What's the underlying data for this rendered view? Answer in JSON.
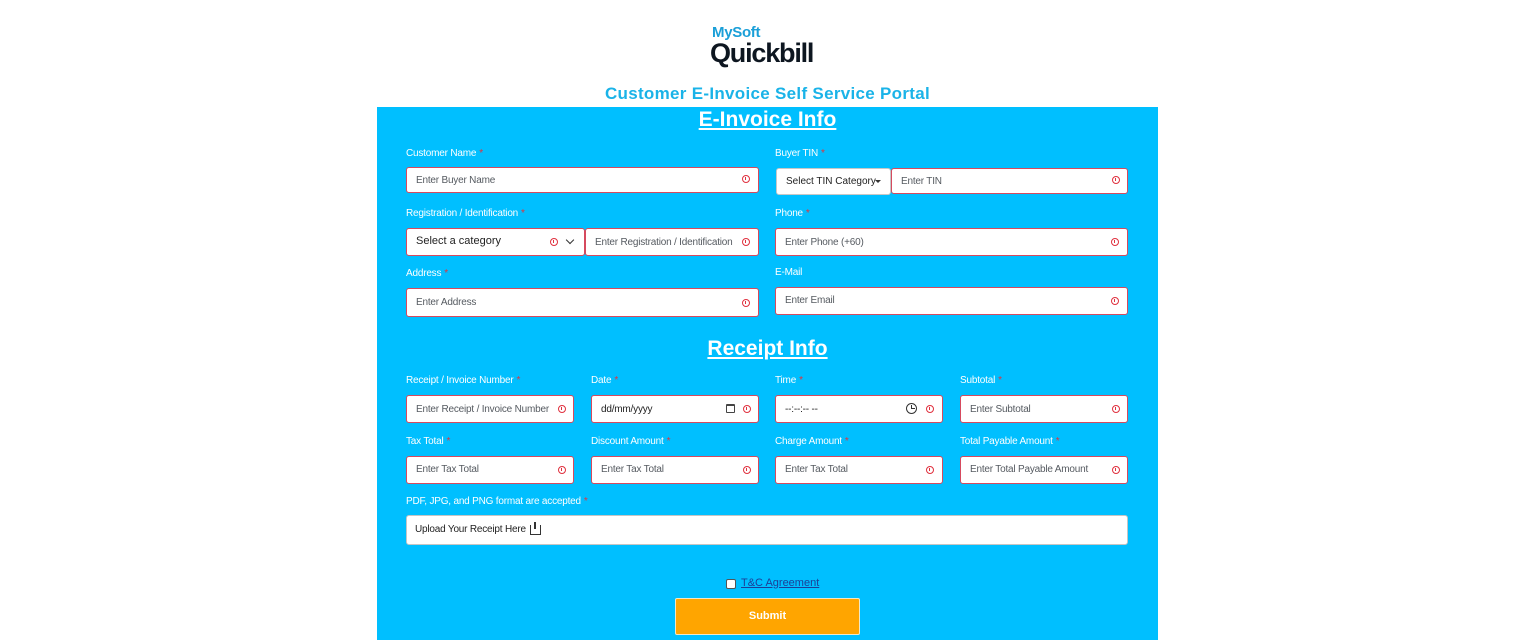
{
  "logo": {
    "brand_top": "MySoft",
    "brand_main": "Quickbill"
  },
  "portal_title": "Customer E-Invoice Self Service Portal",
  "einvoice": {
    "section_title": "E-Invoice Info",
    "customer_name": {
      "label": "Customer Name",
      "required": "*",
      "placeholder": "Enter Buyer Name"
    },
    "buyer_tin": {
      "label": "Buyer TIN",
      "required": "*",
      "select_value": "Select TIN Category",
      "placeholder": "Enter TIN"
    },
    "registration": {
      "label": "Registration / Identification",
      "required": "*",
      "select_value": "Select a category",
      "placeholder": "Enter Registration / Identification"
    },
    "phone": {
      "label": "Phone",
      "required": "*",
      "placeholder": "Enter Phone (+60)"
    },
    "address": {
      "label": "Address",
      "required": "*",
      "placeholder": "Enter Address"
    },
    "email": {
      "label": "E-Mail",
      "placeholder": "Enter Email"
    }
  },
  "receipt": {
    "section_title": "Receipt Info",
    "invoice_number": {
      "label": "Receipt / Invoice Number",
      "required": "*",
      "placeholder": "Enter Receipt / Invoice Number"
    },
    "date": {
      "label": "Date",
      "required": "*",
      "placeholder": "dd/mm/yyyy"
    },
    "time": {
      "label": "Time",
      "required": "*",
      "placeholder": "--:--:-- --"
    },
    "subtotal": {
      "label": "Subtotal",
      "required": "*",
      "placeholder": "Enter Subtotal"
    },
    "tax_total": {
      "label": "Tax Total",
      "required": "*",
      "placeholder": "Enter Tax Total"
    },
    "discount_amount": {
      "label": "Discount Amount",
      "required": "*",
      "placeholder": "Enter Tax Total"
    },
    "charge_amount": {
      "label": "Charge Amount",
      "required": "*",
      "placeholder": "Enter Tax Total"
    },
    "total_payable": {
      "label": "Total Payable Amount",
      "required": "*",
      "placeholder": "Enter Total Payable Amount"
    },
    "upload": {
      "label": "PDF, JPG, and PNG format are accepted",
      "required": "*",
      "text": "Upload Your Receipt Here",
      "icon": "upload-icon"
    }
  },
  "agreement": {
    "label": "T&C Agreement"
  },
  "submit": {
    "label": "Submit"
  },
  "colors": {
    "form_background": "#00bfff",
    "accent_title": "#1ab3e8",
    "required": "#e8303a",
    "submit": "#ffa500",
    "error_border": "#d64a5e"
  }
}
